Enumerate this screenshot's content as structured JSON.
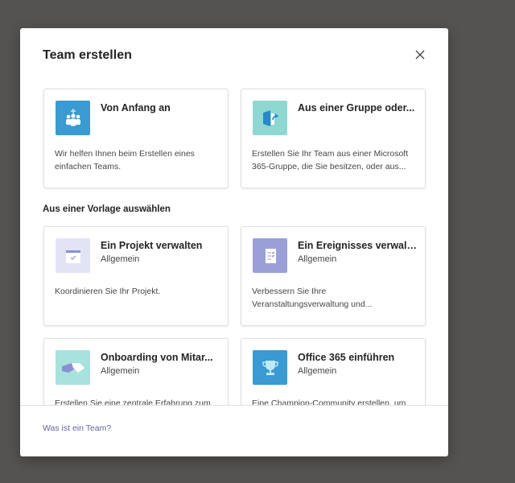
{
  "dialog": {
    "title": "Team erstellen",
    "close_icon": "close-icon",
    "footer_link": "Was ist ein Team?"
  },
  "top_cards": [
    {
      "title": "Von Anfang an",
      "description": "Wir helfen Ihnen beim Erstellen eines einfachen Teams.",
      "icon": "team-add-icon",
      "color": "#3a9ad1"
    },
    {
      "title": "Aus einer Gruppe oder...",
      "description": "Erstellen Sie Ihr Team aus einer Microsoft 365-Gruppe, die Sie besitzen, oder aus...",
      "icon": "group-import-icon",
      "color": "#8fd8d2"
    }
  ],
  "section_heading": "Aus einer Vorlage auswählen",
  "templates": [
    {
      "title": "Ein Projekt verwalten",
      "category": "Allgemein",
      "description": "Koordinieren Sie Ihr Projekt.",
      "icon": "calendar-check-icon",
      "color": "#e2e3f5"
    },
    {
      "title": "Ein Ereignisses verwalt...",
      "category": "Allgemein",
      "description": "Verbessern Sie Ihre Veranstaltungsverwaltung und...",
      "icon": "checklist-icon",
      "color": "#9b9fd8"
    },
    {
      "title": "Onboarding von Mitar...",
      "category": "Allgemein",
      "description": "Erstellen Sie eine zentrale Erfahrung zum",
      "icon": "handshake-icon",
      "color": "#a8e2dd"
    },
    {
      "title": "Office 365 einführen",
      "category": "Allgemein",
      "description": "Eine Champion-Community erstellen, um",
      "icon": "trophy-icon",
      "color": "#3a9ad1"
    }
  ]
}
